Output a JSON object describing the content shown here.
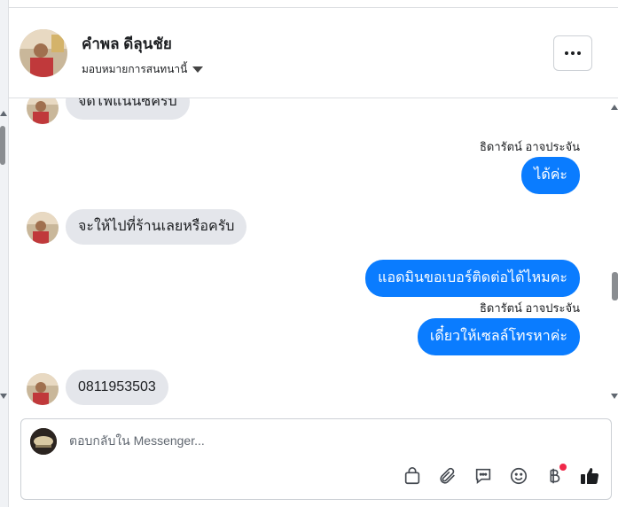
{
  "header": {
    "name": "คำพล ดีลุนชัย",
    "assign_label": "มอบหมายการสนทนานี้"
  },
  "thread": {
    "messages": [
      {
        "dir": "in",
        "text": "จัดไฟแนนซ์ครับ"
      },
      {
        "dir": "out",
        "sender": "ธิดารัตน์ อาจประจัน",
        "text": "ได้ค่ะ"
      },
      {
        "dir": "in",
        "text": "จะให้ไปที่ร้านเลยหรือครับ"
      },
      {
        "dir": "out",
        "text": "แอดมินขอเบอร์ติดต่อได้ไหมคะ"
      },
      {
        "dir": "out",
        "sender": "ธิดารัตน์ อาจประจัน",
        "text": "เดี๋ยวให้เซลล์โทรหาค่ะ"
      },
      {
        "dir": "in",
        "text": "0811953503"
      }
    ]
  },
  "composer": {
    "placeholder": "ตอบกลับใน Messenger..."
  },
  "icons": {
    "more": "more-options-icon",
    "bag": "shopping-bag-icon",
    "attach": "paperclip-icon",
    "saved_replies": "chat-bubble-icon",
    "emoji": "smiley-icon",
    "payment": "baht-icon",
    "like": "thumbs-up-icon"
  },
  "colors": {
    "outgoing_bubble": "#0a7cff",
    "incoming_bubble": "#e4e6eb",
    "notification_dot": "#f02849"
  }
}
